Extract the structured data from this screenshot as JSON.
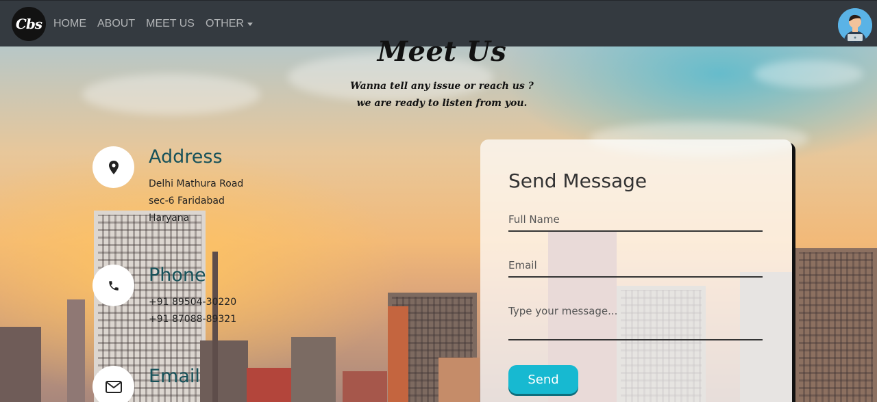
{
  "navbar": {
    "logo_text": "Cbs",
    "links": [
      "HOME",
      "ABOUT",
      "MEET US",
      "OTHER"
    ]
  },
  "hero": {
    "title": "Meet Us",
    "subtitle_line1": "Wanna tell any issue or reach us ?",
    "subtitle_line2": "we are ready to listen from you."
  },
  "contact": {
    "address": {
      "title": "Address",
      "lines": [
        "Delhi Mathura Road",
        "sec-6 Faridabad",
        "Haryana"
      ],
      "icon": "location-pin-icon"
    },
    "phone": {
      "title": "Phone",
      "lines": [
        "+91 89504-30220",
        "+91 87088-89321"
      ],
      "icon": "phone-icon"
    },
    "email": {
      "title": "Email",
      "icon": "envelope-icon"
    }
  },
  "form": {
    "title": "Send Message",
    "full_name_placeholder": "Full Name",
    "email_placeholder": "Email",
    "message_placeholder": "Type your message...",
    "send_label": "Send"
  },
  "colors": {
    "navbar": "#343a40",
    "accent": "#17b9d1",
    "info_title": "#17525a"
  }
}
